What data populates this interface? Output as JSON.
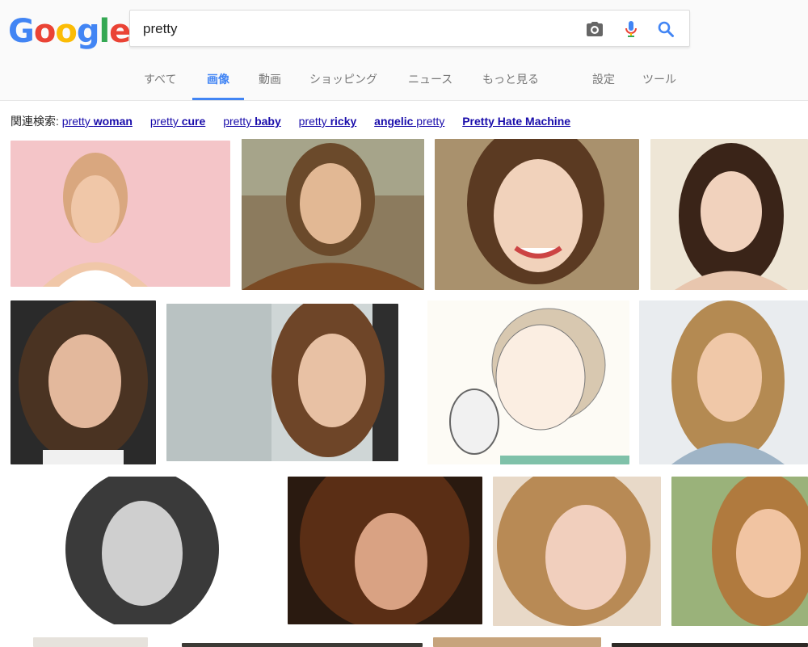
{
  "logo": {
    "letters": [
      "G",
      "o",
      "o",
      "g",
      "l",
      "e"
    ],
    "colors": [
      "#4285f4",
      "#ea4335",
      "#fbbc05",
      "#4285f4",
      "#34a853",
      "#ea4335"
    ]
  },
  "search": {
    "query": "pretty"
  },
  "icons": {
    "camera": "camera-icon",
    "mic": "mic-icon",
    "search": "search-icon"
  },
  "tabs": [
    {
      "label": "すべて"
    },
    {
      "label": "画像",
      "active": true
    },
    {
      "label": "動画"
    },
    {
      "label": "ショッピング"
    },
    {
      "label": "ニュース"
    },
    {
      "label": "もっと見る"
    },
    {
      "label": "設定"
    },
    {
      "label": "ツール"
    }
  ],
  "related": {
    "prefix": "関連検索:",
    "links": [
      {
        "plain": "pretty ",
        "bold": "woman"
      },
      {
        "plain": "pretty ",
        "bold": "cure"
      },
      {
        "plain": "pretty ",
        "bold": "baby"
      },
      {
        "plain": "pretty ",
        "bold": "ricky"
      },
      {
        "plain": "",
        "bold": "angelic",
        "after": " pretty"
      },
      {
        "plain": "",
        "bold": "Pretty Hate Machine"
      }
    ]
  },
  "colors": {
    "accent": "#4285f4",
    "link": "#1a0dab"
  }
}
